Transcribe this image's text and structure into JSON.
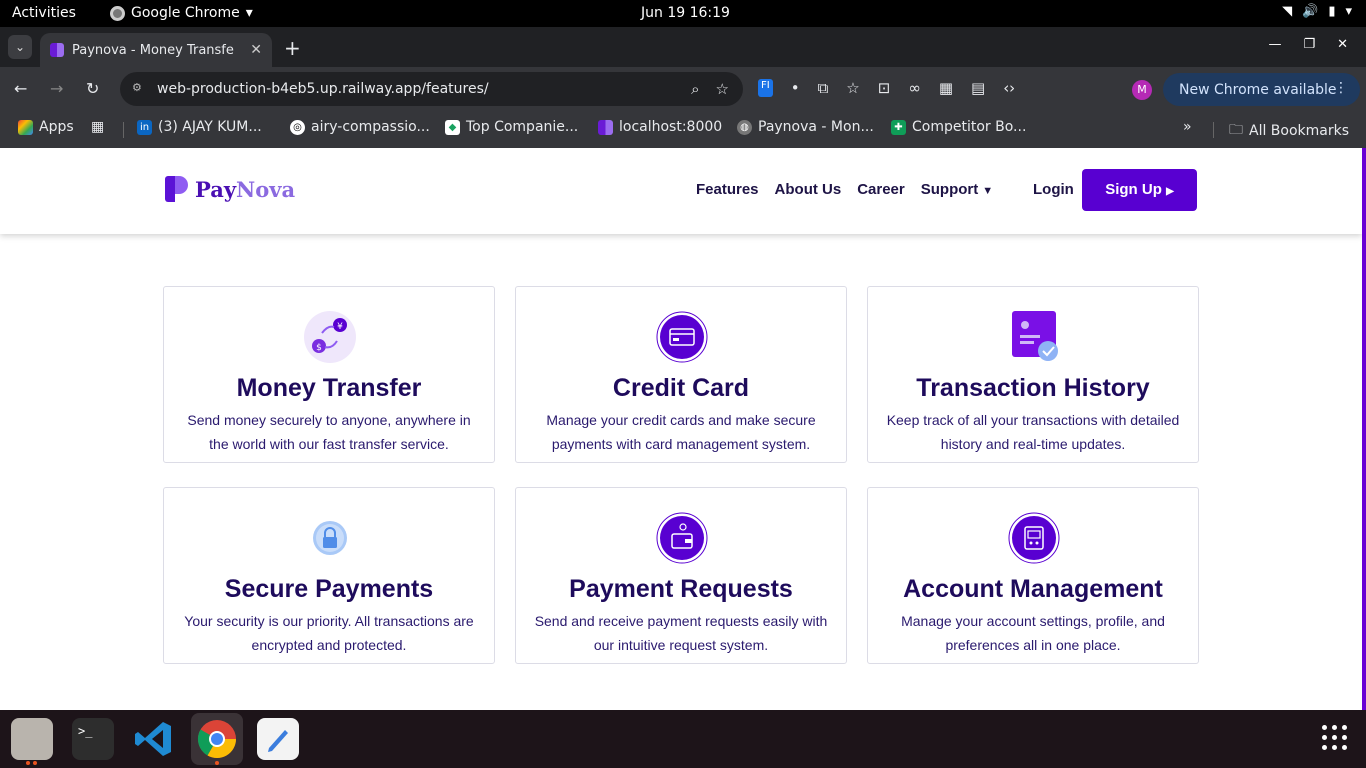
{
  "system": {
    "activities": "Activities",
    "app_name": "Google Chrome",
    "clock": "Jun 19  16:19"
  },
  "browser": {
    "tab_title": "Paynova - Money Transfe",
    "url": "web-production-b4eb5.up.railway.app/features/",
    "update_label": "New Chrome available",
    "profile_initial": "M",
    "bookmarks": [
      {
        "label": "Apps"
      },
      {
        "label": "(3) AJAY KUM..."
      },
      {
        "label": "airy-compassio..."
      },
      {
        "label": "Top Companie..."
      },
      {
        "label": "localhost:8000"
      },
      {
        "label": "Paynova - Mon..."
      },
      {
        "label": "Competitor Bo..."
      }
    ],
    "all_bookmarks": "All Bookmarks"
  },
  "site": {
    "logo_pay": "Pay",
    "logo_nova": "Nova",
    "nav": {
      "features": "Features",
      "about": "About Us",
      "career": "Career",
      "support": "Support"
    },
    "login": "Login",
    "signup": "Sign Up"
  },
  "features": [
    {
      "title": "Money Transfer",
      "desc": "Send money securely to anyone, anywhere in the world with our fast transfer service.",
      "icon": "money-transfer-icon"
    },
    {
      "title": "Credit Card",
      "desc": "Manage your credit cards and make secure payments with card management system.",
      "icon": "credit-card-icon"
    },
    {
      "title": "Transaction History",
      "desc": "Keep track of all your transactions with detailed history and real-time updates.",
      "icon": "transaction-history-icon"
    },
    {
      "title": "Secure Payments",
      "desc": "Your security is our priority. All transactions are encrypted and protected.",
      "icon": "lock-icon"
    },
    {
      "title": "Payment Requests",
      "desc": "Send and receive payment requests easily with our intuitive request system.",
      "icon": "wallet-icon"
    },
    {
      "title": "Account Management",
      "desc": "Manage your account settings, profile, and preferences all in one place.",
      "icon": "account-icon"
    }
  ],
  "colors": {
    "brand": "#5800d1",
    "heading": "#1e0b5c"
  }
}
